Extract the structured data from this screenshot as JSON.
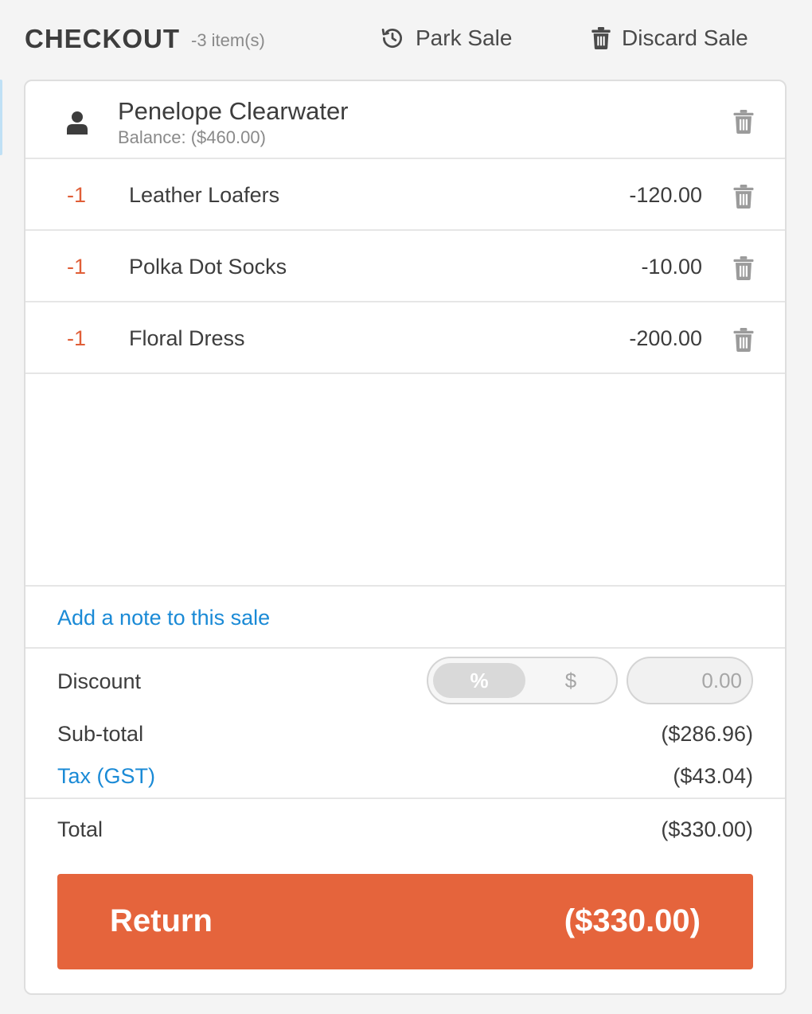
{
  "header": {
    "title": "CHECKOUT",
    "item_count": "-3 item(s)",
    "park_sale_label": "Park Sale",
    "discard_sale_label": "Discard Sale"
  },
  "customer": {
    "name": "Penelope Clearwater",
    "balance": "Balance: ($460.00)"
  },
  "line_items": [
    {
      "qty": "-1",
      "name": "Leather Loafers",
      "price": "-120.00"
    },
    {
      "qty": "-1",
      "name": "Polka Dot Socks",
      "price": "-10.00"
    },
    {
      "qty": "-1",
      "name": "Floral Dress",
      "price": "-200.00"
    }
  ],
  "note_link": "Add a note to this sale",
  "discount": {
    "label": "Discount",
    "percent_label": "%",
    "dollar_label": "$",
    "selected": "%",
    "placeholder": "0.00"
  },
  "summary": {
    "subtotal_label": "Sub-total",
    "subtotal_value": "($286.96)",
    "tax_label": "Tax (GST)",
    "tax_value": "($43.04)",
    "total_label": "Total",
    "total_value": "($330.00)"
  },
  "return_button": {
    "label": "Return",
    "amount": "($330.00)"
  },
  "colors": {
    "accent": "#e5643c",
    "link": "#1a8ad6",
    "quantity": "#e05e37"
  }
}
